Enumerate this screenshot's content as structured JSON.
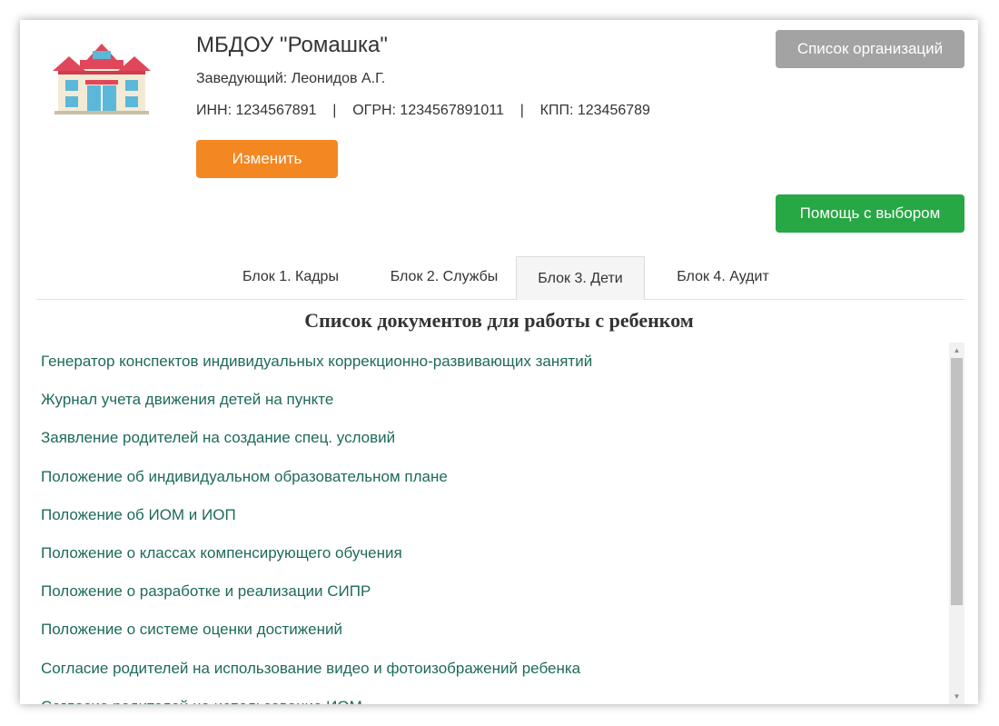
{
  "org": {
    "title": "МБДОУ \"Ромашка\"",
    "head": "Заведующий: Леонидов А.Г.",
    "ids": "ИНН: 1234567891    |    ОГРН: 1234567891011    |    КПП: 123456789",
    "icon": "building-icon"
  },
  "buttons": {
    "edit": "Изменить",
    "org_list": "Список организаций",
    "help": "Помощь с выбором"
  },
  "colors": {
    "edit": "#f38722",
    "org_list": "#a3a3a3",
    "help": "#28a745",
    "link": "#1e6a5a"
  },
  "tabs": [
    {
      "label": "Блок 1. Кадры",
      "active": false
    },
    {
      "label": "Блок 2. Службы",
      "active": false
    },
    {
      "label": "Блок 3. Дети",
      "active": true
    },
    {
      "label": "Блок 4. Аудит",
      "active": false
    }
  ],
  "documents": {
    "title": "Список документов для работы с ребенком",
    "items": [
      "Генератор конспектов индивидуальных коррекционно-развивающих занятий",
      "Журнал учета движения детей на пункте",
      "Заявление родителей на создание спец. условий",
      "Положение об индивидуальном образовательном плане",
      "Положение об ИОМ и ИОП",
      "Положение о классах компенсирующего обучения",
      "Положение о разработке и реализации СИПР",
      "Положение о системе оценки достижений",
      "Согласие родителей на использование видео и фотоизображений ребенка",
      "Согласие родителей на использование ИОМ"
    ]
  }
}
